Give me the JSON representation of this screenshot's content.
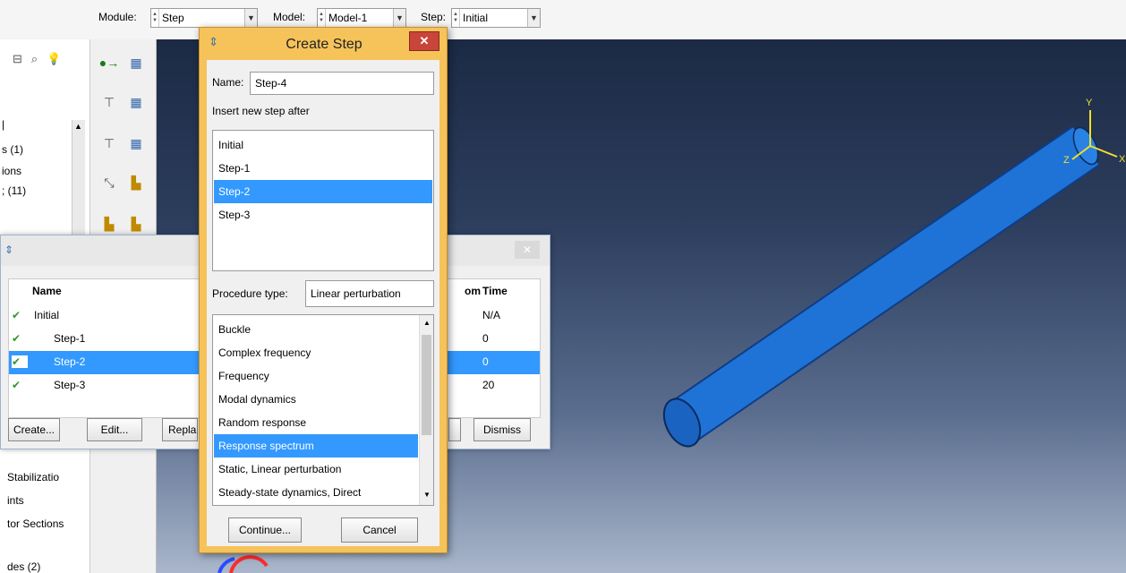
{
  "toolbar": {
    "module_label": "Module:",
    "module_value": "Step",
    "model_label": "Model:",
    "model_value": "Model-1",
    "step_label": "Step:",
    "step_value": "Initial"
  },
  "tree": {
    "upper_items": [
      "s (1)",
      "ions",
      "; (11)"
    ],
    "lower_items": [
      "Stabilizatio",
      "ints",
      "tor Sections",
      "des (2)"
    ]
  },
  "step_manager": {
    "columns": [
      "Name",
      "om",
      "Time"
    ],
    "rows": [
      {
        "name": "Initial",
        "time": "N/A",
        "selected": false
      },
      {
        "name": "Step-1",
        "time": "0",
        "selected": false
      },
      {
        "name": "Step-2",
        "time": "0",
        "selected": true
      },
      {
        "name": "Step-3",
        "time": "20",
        "selected": false
      }
    ],
    "buttons": {
      "create": "Create...",
      "edit": "Edit...",
      "replace": "Repla",
      "dismiss": "Dismiss"
    }
  },
  "create_step": {
    "title": "Create Step",
    "name_label": "Name:",
    "name_value": "Step-4",
    "insert_label": "Insert new step after",
    "steps": [
      "Initial",
      "Step-1",
      "Step-2",
      "Step-3"
    ],
    "selected_step": "Step-2",
    "procedure_label": "Procedure type:",
    "procedure_value": "Linear perturbation",
    "procedures": [
      "Buckle",
      "Complex frequency",
      "Frequency",
      "Modal dynamics",
      "Random response",
      "Response spectrum",
      "Static, Linear perturbation",
      "Steady-state dynamics, Direct"
    ],
    "selected_procedure": "Response spectrum",
    "continue_button": "Continue...",
    "cancel_button": "Cancel"
  },
  "axes": {
    "y": "Y",
    "x": "X",
    "z": "Z"
  },
  "colors": {
    "selection": "#3399ff",
    "dialog_frame": "#f6c35a",
    "pipe": "#1f73d6"
  }
}
